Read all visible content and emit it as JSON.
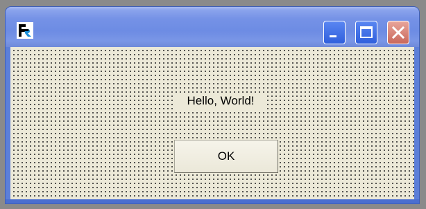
{
  "window": {
    "icon": "app-logo-icon",
    "buttons": {
      "minimize": "minimize-icon",
      "maximize": "maximize-icon",
      "close": "close-icon"
    }
  },
  "content": {
    "message": "Hello, World!",
    "ok_label": "OK"
  },
  "colors": {
    "titlebar": "#7592e6",
    "client_bg": "#ece9d8",
    "close_button": "#c9685b"
  }
}
